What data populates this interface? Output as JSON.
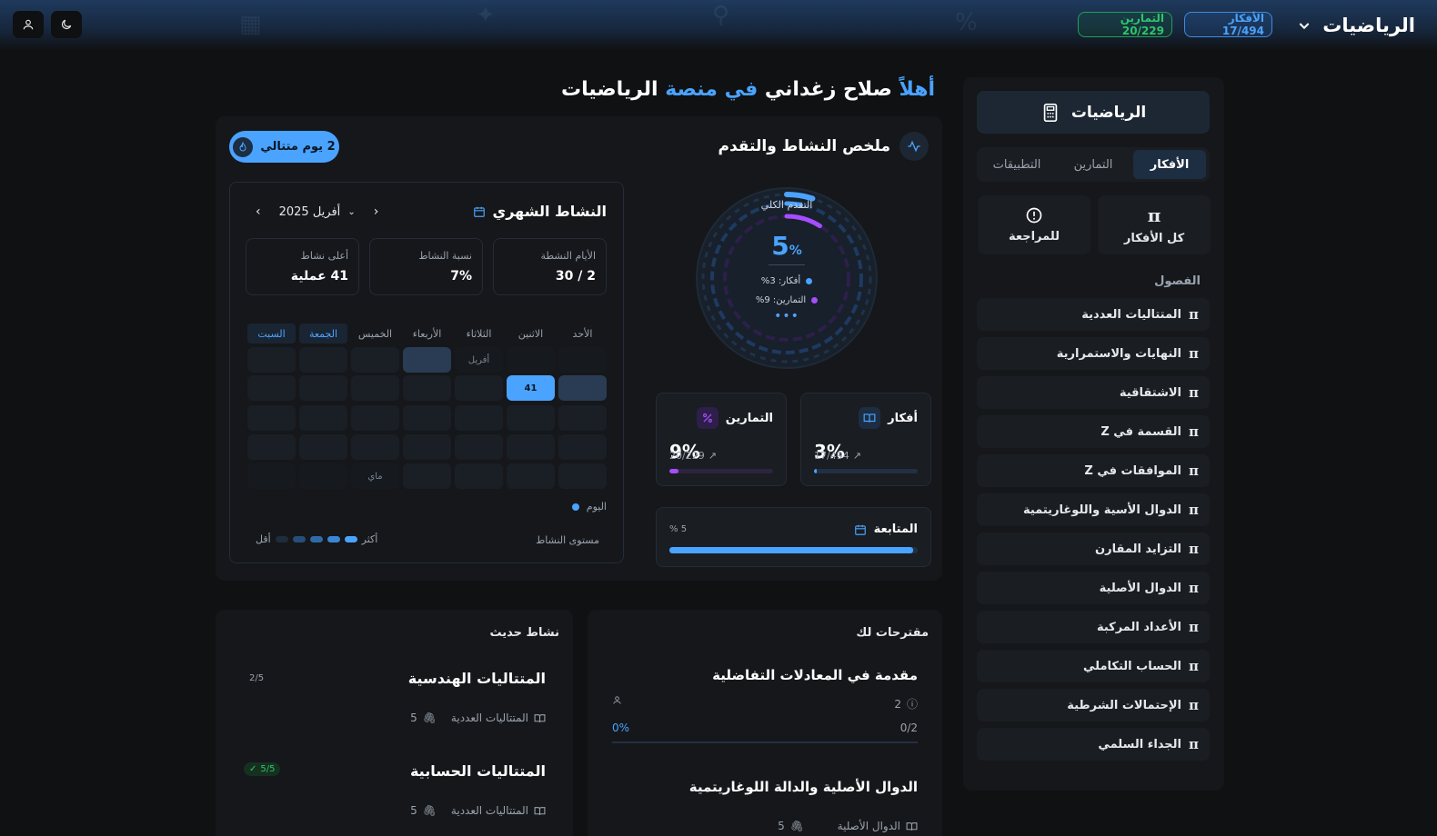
{
  "topbar": {
    "brand": "الرياضيات",
    "ideas_pill": "الأفكار 17/494",
    "exercises_pill": "التمارين 20/229"
  },
  "sidebar": {
    "title": "الرياضيات",
    "tabs": [
      {
        "label": "الأفكار",
        "active": true
      },
      {
        "label": "التمارين",
        "active": false
      },
      {
        "label": "التطبيقات",
        "active": false
      }
    ],
    "cards": [
      {
        "label": "كل الأفكار",
        "icon": "pi-icon"
      },
      {
        "label": "للمراجعة",
        "icon": "alert-circle-icon"
      }
    ],
    "section_label": "الفصول",
    "chapters": [
      "المتتاليات العددية",
      "النهايات والاستمرارية",
      "الاشتقاقية",
      "القسمة في Z",
      "الموافقات في Z",
      "الدوال الأسية واللوغاريتمية",
      "التزايد المقارن",
      "الدوال الأصلية",
      "الأعداد المركبة",
      "الحساب التكاملي",
      "الإحتمالات الشرطية",
      "الجداء السلمي"
    ]
  },
  "greeting": {
    "part1": "أهلاً",
    "name": " صلاح زغداني ",
    "part2": "في",
    "part3": " منصة ",
    "part4": "الرياضيات"
  },
  "summary": {
    "title": "ملخص النشاط والتقدم",
    "streak": "2 يوم متتالي",
    "ring": {
      "label": "التقدم الكلي",
      "value": "5",
      "unit": "%",
      "ideas_line": "أفكار: 3%",
      "exercises_line": "التمارين: 9%",
      "ideas_fraction": 0.03,
      "exercises_fraction": 0.09,
      "total_fraction": 0.05
    },
    "ideas_card": {
      "name": "أفكار",
      "pct": "3%",
      "sub": "17/494",
      "fraction": 0.03
    },
    "exercises_card": {
      "name": "التمارين",
      "pct": "9%",
      "sub": "20/229",
      "fraction": 0.09
    },
    "followup": {
      "name": "المتابعة",
      "pct": "5 %",
      "fraction": 0.98
    }
  },
  "calendar": {
    "title": "النشاط الشهري",
    "month": "أفريل 2025",
    "stats": [
      {
        "label": "الأيام النشطة",
        "value": "2 / 30"
      },
      {
        "label": "نسبة النشاط",
        "value": "7%"
      },
      {
        "label": "أعلى نشاط",
        "value": "41 عملية"
      }
    ],
    "weekdays": [
      "الأحد",
      "الاثنين",
      "الثلاثاء",
      "الأربعاء",
      "الخميس",
      "الجمعة",
      "السبت"
    ],
    "april_label": "أفريل",
    "may_label": "ماي",
    "today_value": "41",
    "legend_today": "اليوم",
    "legend_level": "مستوى النشاط",
    "legend_less": "أقل",
    "legend_more": "أكثر"
  },
  "suggestions": {
    "title": "مقترحات لك",
    "items": [
      {
        "title": "مقدمة في المعادلات التفاضلية",
        "count": "2",
        "progress": "0/2",
        "pct": "0%"
      },
      {
        "title": "الدوال الأصلية والدالة اللوغاريتمية",
        "chapter": "الدوال الأصلية",
        "attachments": "5"
      }
    ]
  },
  "recent": {
    "title": "نشاط حديث",
    "items": [
      {
        "title": "المتتاليات الهندسية",
        "badge": "2/5",
        "chapter": "المتتاليات العددية",
        "attachments": "5"
      },
      {
        "title": "المتتاليات الحسابية",
        "badge": "5/5",
        "chapter": "المتتاليات العددية",
        "attachments": "5"
      }
    ]
  },
  "colors": {
    "accent": "#4aa3ff",
    "purple": "#a64dff",
    "green": "#2ec46c",
    "background": "#101113"
  }
}
